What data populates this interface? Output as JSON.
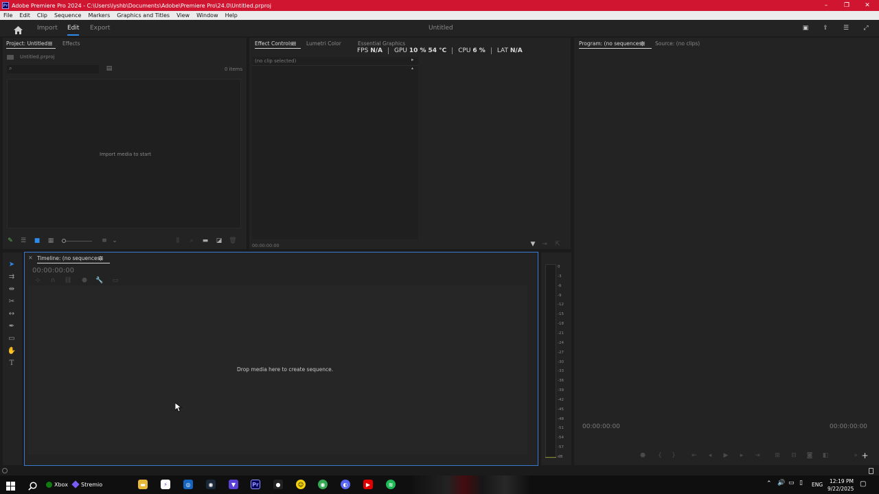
{
  "window": {
    "title": "Adobe Premiere Pro 2024 - C:\\Users\\lyshb\\Documents\\Adobe\\Premiere Pro\\24.0\\Untitled.prproj",
    "app_badge": "Pr",
    "minimize": "–",
    "maximize": "❐",
    "close": "✕"
  },
  "menu": [
    "File",
    "Edit",
    "Clip",
    "Sequence",
    "Markers",
    "Graphics and Titles",
    "View",
    "Window",
    "Help"
  ],
  "header": {
    "tabs": [
      "Import",
      "Edit",
      "Export"
    ],
    "active_tab": "Edit",
    "project_title": "Untitled"
  },
  "project_panel": {
    "tabs": [
      "Project: Untitled",
      "Effects"
    ],
    "file_name": "Untitled.prproj",
    "item_count": "0 items",
    "empty_message": "Import media to start"
  },
  "effects_panel": {
    "tabs": [
      "Effect Controls",
      "Lumetri Color",
      "Essential Graphics"
    ],
    "no_clip": "(no clip selected)",
    "timecode": "00:00:00:00"
  },
  "perf": {
    "fps_label": "FPS",
    "fps_value": "N/A",
    "gpu_label": "GPU",
    "gpu_value": "10 %",
    "gpu_temp": "54 °C",
    "cpu_label": "CPU",
    "cpu_value": "6 %",
    "lat_label": "LAT",
    "lat_value": "N/A"
  },
  "program_panel": {
    "tabs": [
      "Program: (no sequences)",
      "Source: (no clips)"
    ],
    "timecode_left": "00:00:00:00",
    "timecode_right": "00:00:00:00"
  },
  "timeline": {
    "tab": "Timeline: (no sequences)",
    "close": "×",
    "timecode": "00:00:00:00",
    "empty_message": "Drop media here to create sequence."
  },
  "audio_meter": {
    "scale": [
      "0",
      "-3",
      "-6",
      "-9",
      "-12",
      "-15",
      "-18",
      "-21",
      "-24",
      "-27",
      "-30",
      "-33",
      "-36",
      "-39",
      "-42",
      "-45",
      "-48",
      "-51",
      "-54",
      "-57",
      "dB"
    ]
  },
  "taskbar": {
    "xbox": "Xbox",
    "stremio": "Stremio",
    "language": "ENG",
    "time": "12:19 PM",
    "date": "9/22/2025"
  },
  "colors": {
    "titlebar": "#d01531",
    "accent_blue": "#2d8ceb",
    "panel_bg": "#232323",
    "selected_panel_border": "#3a7bd5"
  }
}
